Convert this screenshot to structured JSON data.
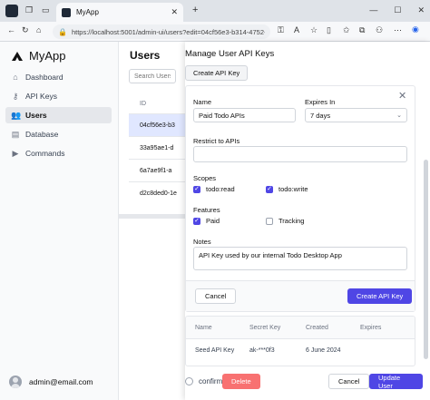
{
  "browser": {
    "tab_title": "MyApp",
    "url": "https://localhost:5001/admin-ui/users?edit=04cf56e3-b314-4752-..."
  },
  "sidebar": {
    "brand": "MyApp",
    "items": [
      {
        "label": "Dashboard",
        "icon": "home-icon"
      },
      {
        "label": "API Keys",
        "icon": "key-icon"
      },
      {
        "label": "Users",
        "icon": "users-icon"
      },
      {
        "label": "Database",
        "icon": "database-icon"
      },
      {
        "label": "Commands",
        "icon": "terminal-icon"
      }
    ],
    "active_item": "Users",
    "user_email": "admin@email.com"
  },
  "users_page": {
    "title": "Users",
    "search_placeholder": "Search Users",
    "table_header": "ID",
    "rows": [
      "04cf56e3-b3",
      "33a95ae1-d",
      "6a7ae9f1-a",
      "d2c8ded0-1e"
    ]
  },
  "modal": {
    "title": "Manage User API Keys",
    "create_key_label": "Create API Key",
    "form": {
      "name_label": "Name",
      "name_value": "Paid Todo APIs",
      "expires_label": "Expires In",
      "expires_value": "7 days",
      "restrict_label": "Restrict to APIs",
      "restrict_value": "",
      "scopes_label": "Scopes",
      "scopes": [
        {
          "label": "todo:read",
          "checked": true
        },
        {
          "label": "todo:write",
          "checked": true
        }
      ],
      "features_label": "Features",
      "features": [
        {
          "label": "Paid",
          "checked": true
        },
        {
          "label": "Tracking",
          "checked": false
        }
      ],
      "notes_label": "Notes",
      "notes_value": "API Key used by our internal Todo Desktop App",
      "cancel_label": "Cancel",
      "submit_label": "Create API Key"
    },
    "keys_table": {
      "headers": [
        "Name",
        "Secret Key",
        "Created",
        "Expires"
      ],
      "rows": [
        {
          "name": "Seed API Key",
          "secret": "ak-***0f3",
          "created": "6 June 2024",
          "expires": ""
        }
      ]
    },
    "footer": {
      "confirm_label": "confirm",
      "delete_label": "Delete",
      "cancel_label": "Cancel",
      "update_label": "Update User"
    }
  },
  "colors": {
    "primary": "#4f46e5",
    "danger": "#f87171",
    "active_row": "#e0e7ff"
  }
}
